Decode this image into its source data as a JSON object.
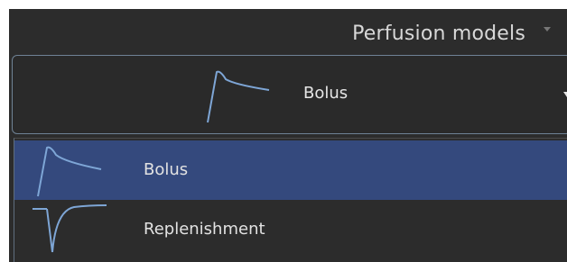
{
  "header": {
    "title": "Perfusion models",
    "dropdown_icon": "caret-down-icon"
  },
  "combo": {
    "selected_label": "Bolus",
    "icon": "bolus-curve-icon",
    "dropdown_icon": "caret-down-icon"
  },
  "options": [
    {
      "label": "Bolus",
      "icon": "bolus-curve-icon",
      "selected": true
    },
    {
      "label": "Replenishment",
      "icon": "replenishment-curve-icon",
      "selected": false
    }
  ],
  "colors": {
    "panel_background": "#2c2c2c",
    "selected_background": "#34497d",
    "combo_border": "#6f8295",
    "curve_stroke": "#7ea6d6",
    "text": "#e2e2e2"
  }
}
